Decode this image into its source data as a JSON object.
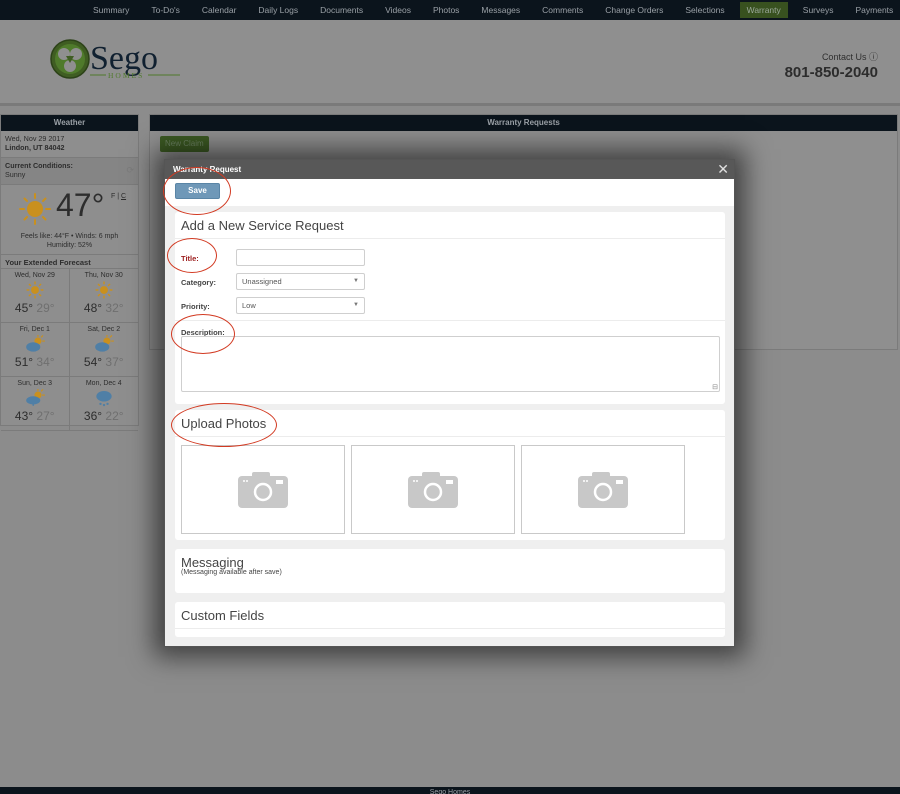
{
  "nav": {
    "items": [
      {
        "label": "Summary",
        "active": false
      },
      {
        "label": "To-Do's",
        "active": false
      },
      {
        "label": "Calendar",
        "active": false
      },
      {
        "label": "Daily Logs",
        "active": false
      },
      {
        "label": "Documents",
        "active": false
      },
      {
        "label": "Videos",
        "active": false
      },
      {
        "label": "Photos",
        "active": false
      },
      {
        "label": "Messages",
        "active": false
      },
      {
        "label": "Comments",
        "active": false
      },
      {
        "label": "Change Orders",
        "active": false
      },
      {
        "label": "Selections",
        "active": false
      },
      {
        "label": "Warranty",
        "active": true
      },
      {
        "label": "Surveys",
        "active": false
      },
      {
        "label": "Payments",
        "active": false
      }
    ],
    "settings_icon": "gear-icon",
    "active_color": "#4f7a2b"
  },
  "header": {
    "logo_text": "Sego",
    "logo_subtext": "HOMES",
    "contact_label": "Contact Us",
    "contact_icon": "info-icon",
    "phone": "801-850-2040"
  },
  "weather": {
    "title": "Weather",
    "date": "Wed, Nov 29 2017",
    "location": "Lindon, UT 84042",
    "conditions_label": "Current Conditions:",
    "conditions": "Sunny",
    "temp": "47°",
    "unit_f": "F",
    "unit_c": "C",
    "feels_line": "Feels like: 44°F • Winds: 6 mph",
    "humidity_line": "Humidity: 52%",
    "forecast_title": "Your Extended Forecast",
    "forecast": [
      {
        "day": "Wed, Nov 29",
        "icon": "sun-icon",
        "hi": "45°",
        "lo": "29°"
      },
      {
        "day": "Thu, Nov 30",
        "icon": "sun-icon",
        "hi": "48°",
        "lo": "32°"
      },
      {
        "day": "Fri, Dec 1",
        "icon": "partly-cloudy-icon",
        "hi": "51°",
        "lo": "34°"
      },
      {
        "day": "Sat, Dec 2",
        "icon": "partly-cloudy-icon",
        "hi": "54°",
        "lo": "37°"
      },
      {
        "day": "Sun, Dec 3",
        "icon": "partly-cloudy-snow-icon",
        "hi": "43°",
        "lo": "27°"
      },
      {
        "day": "Mon, Dec 4",
        "icon": "snow-cloud-icon",
        "hi": "36°",
        "lo": "22°"
      }
    ]
  },
  "main": {
    "title": "Warranty Requests",
    "new_claim_label": "New Claim"
  },
  "modal": {
    "title": "Warranty Request",
    "close_icon": "close-icon",
    "save_label": "Save",
    "service_request": {
      "title": "Add a New Service Request",
      "title_label": "Title:",
      "title_value": "",
      "category_label": "Category:",
      "category_value": "Unassigned",
      "priority_label": "Priority:",
      "priority_value": "Low",
      "description_label": "Description:",
      "description_value": ""
    },
    "upload": {
      "title": "Upload Photos",
      "slots": [
        "camera-icon",
        "camera-icon",
        "camera-icon"
      ]
    },
    "messaging": {
      "title": "Messaging",
      "note": "(Messaging available after save)"
    },
    "custom_fields": {
      "title": "Custom Fields"
    }
  },
  "footer": {
    "text": "Sego Homes"
  },
  "colors": {
    "nav_bg": "#0b141c",
    "brand_green": "#4f7a2b",
    "save_button": "#6f98b8",
    "required_label": "#9c1c1c",
    "annotation_red": "#d23a22"
  }
}
